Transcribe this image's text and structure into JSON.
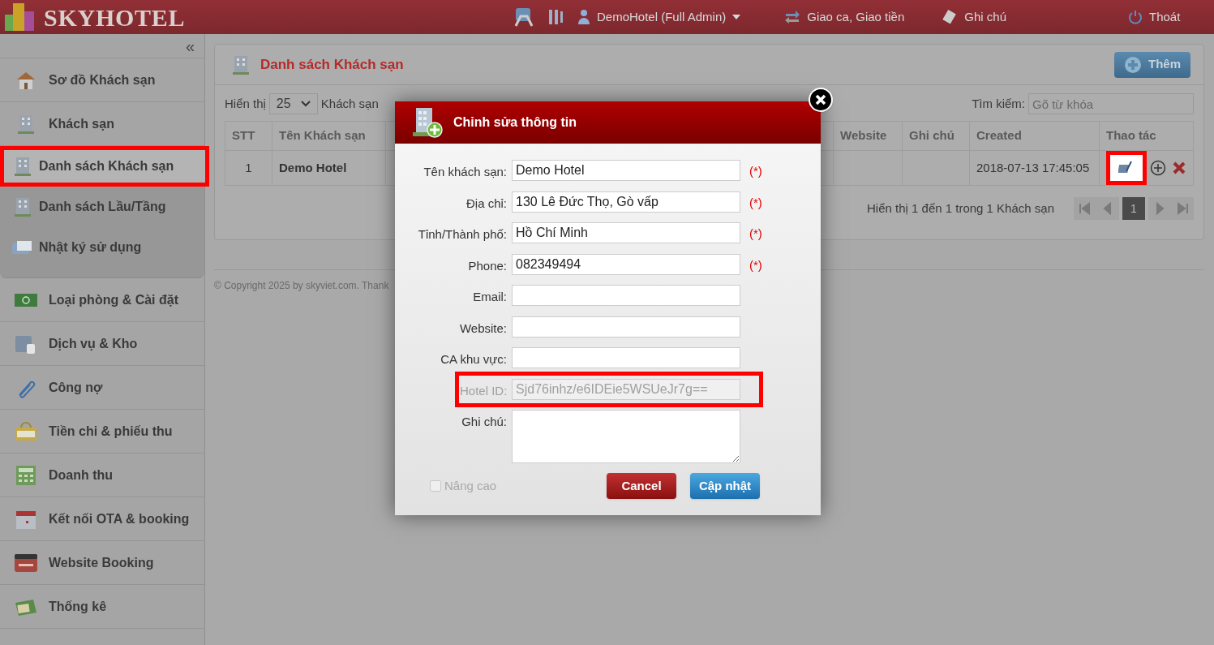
{
  "header": {
    "logo": "SKYHOTEL",
    "user": "DemoHotel (Full Admin)",
    "links": [
      {
        "kind": "shift",
        "label": "Giao ca, Giao tiền"
      },
      {
        "kind": "note",
        "label": "Ghi chú"
      },
      {
        "kind": "logout",
        "label": "Thoát"
      }
    ]
  },
  "sidebar": {
    "collapse": "«",
    "items": [
      {
        "kind": "house",
        "label": "Sơ đồ Khách sạn",
        "selected": false
      },
      {
        "kind": "building",
        "label": "Khách sạn",
        "selected": false,
        "expanded": true,
        "children": [
          {
            "kind": "building",
            "label": "Danh sách Khách sạn",
            "selected": true,
            "highlighted": true
          },
          {
            "kind": "building",
            "label": "Danh sách Lầu/Tầng",
            "selected": false,
            "highlighted": false
          },
          {
            "kind": "log",
            "label": "Nhật ký sử dụng",
            "selected": false,
            "highlighted": false
          }
        ]
      },
      {
        "kind": "money",
        "label": "Loại phòng & Cài đặt",
        "selected": false
      },
      {
        "kind": "folder",
        "label": "Dịch vụ & Kho",
        "selected": false
      },
      {
        "kind": "clip",
        "label": "Công nợ",
        "selected": false
      },
      {
        "kind": "bag",
        "label": "Tiền chi & phiếu thu",
        "selected": false
      },
      {
        "kind": "calc",
        "label": "Doanh thu",
        "selected": false
      },
      {
        "kind": "calendar",
        "label": "Kết nối OTA & booking",
        "selected": false
      },
      {
        "kind": "www",
        "label": "Website Booking",
        "selected": false
      },
      {
        "kind": "chart",
        "label": "Thống kê",
        "selected": false
      }
    ]
  },
  "panel": {
    "title": "Danh sách Khách sạn",
    "add_button": "Thêm",
    "show_label": "Hiển thị",
    "page_size": "25",
    "unit_label": "Khách sạn",
    "search_label": "Tìm kiếm:",
    "search": {
      "placeholder": "Gõ từ khóa"
    },
    "table": {
      "columns": [
        "STT",
        "Tên Khách sạn",
        "",
        "Website",
        "Ghi chú",
        "Created",
        "Thao tác"
      ],
      "rows": [
        {
          "cells": [
            "1",
            "Demo Hotel",
            "",
            "",
            "",
            "2018-07-13 17:45:05"
          ],
          "edit_highlighted": true
        }
      ]
    },
    "info": "Hiển thị 1 đến 1 trong 1 Khách sạn",
    "pages": [
      {
        "label": "1",
        "selected": true
      }
    ]
  },
  "footer": "© Copyright 2025 by skyviet.com. Thank",
  "modal": {
    "title": "Chỉnh sửa thông tin",
    "fields": [
      {
        "kind": "text",
        "label": "Tên khách sạn:",
        "value": "Demo Hotel",
        "required": true,
        "disabled": false,
        "highlighted": false
      },
      {
        "kind": "text",
        "label": "Địa chỉ:",
        "value": "130 Lê Đức Thọ, Gò vấp",
        "required": true,
        "disabled": false,
        "highlighted": false
      },
      {
        "kind": "text",
        "label": "Tỉnh/Thành phố:",
        "value": "Hồ Chí Minh",
        "required": true,
        "disabled": false,
        "highlighted": false
      },
      {
        "kind": "text",
        "label": "Phone:",
        "value": "082349494",
        "required": true,
        "disabled": false,
        "highlighted": false
      },
      {
        "kind": "text",
        "label": "Email:",
        "required": false,
        "disabled": false,
        "highlighted": false
      },
      {
        "kind": "text",
        "label": "Website:",
        "required": false,
        "disabled": false,
        "highlighted": false
      },
      {
        "kind": "text",
        "label": "CA khu vực:",
        "required": false,
        "disabled": false,
        "highlighted": false
      },
      {
        "kind": "text",
        "label": "Hotel ID:",
        "value": "Sjd76inhz/e6IDEie5WSUeJr7g==",
        "required": false,
        "disabled": true,
        "highlighted": true
      },
      {
        "kind": "textarea",
        "label": "Ghi chú:",
        "required": false,
        "disabled": false,
        "highlighted": false
      }
    ],
    "required_mark": "(*)",
    "advanced": {
      "label": "Nâng cao",
      "checked": false,
      "disabled": true
    },
    "cancel": "Cancel",
    "submit": "Cập nhật"
  }
}
